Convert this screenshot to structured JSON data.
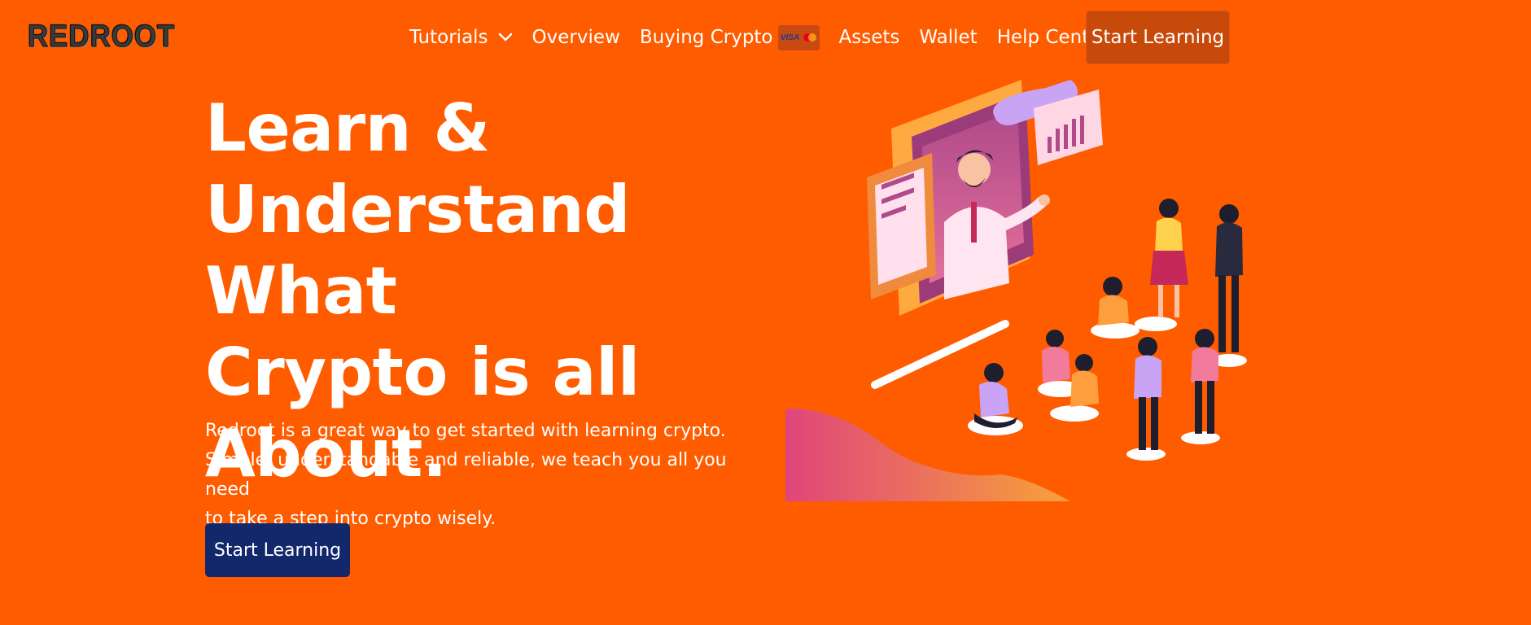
{
  "brand": {
    "logo_text": "REDROOT"
  },
  "nav": {
    "items": [
      {
        "label": "Tutorials",
        "has_dropdown": true
      },
      {
        "label": "Overview"
      },
      {
        "label": "Buying Crypto",
        "badge_icons": [
          "visa-icon",
          "mastercard-icon"
        ]
      },
      {
        "label": "Assets"
      },
      {
        "label": "Wallet"
      },
      {
        "label": "Help Center"
      }
    ],
    "cta_label": "Start Learning"
  },
  "hero": {
    "title_lines": [
      "Learn &",
      "Understand What",
      "Crypto is all",
      "About."
    ],
    "description_lines": [
      "Redroot is a great way to get started with learning crypto.",
      "Simple, understandable and reliable, we teach you all you need",
      "to take a step into crypto wisely."
    ],
    "cta_label": "Start Learning"
  },
  "cards": {
    "visa_text": "VISA"
  },
  "colors": {
    "background": "#ff5c00",
    "nav_cta": "#c84a0a",
    "hero_cta": "#12286b",
    "text": "#ffffff"
  }
}
